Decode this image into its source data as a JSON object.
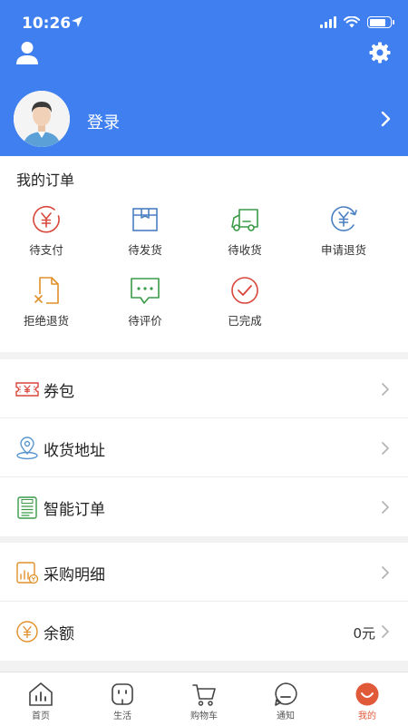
{
  "status_bar": {
    "time": "10:26"
  },
  "header": {
    "login_label": "登录"
  },
  "orders": {
    "title": "我的订单",
    "items": [
      {
        "label": "待支付",
        "icon": "yuan-circle-icon"
      },
      {
        "label": "待发货",
        "icon": "package-box-icon"
      },
      {
        "label": "待收货",
        "icon": "delivery-truck-icon"
      },
      {
        "label": "申请退货",
        "icon": "refund-cycle-icon"
      },
      {
        "label": "拒绝退货",
        "icon": "rejected-document-icon"
      },
      {
        "label": "待评价",
        "icon": "comment-bubble-icon"
      },
      {
        "label": "已完成",
        "icon": "check-circle-icon"
      }
    ]
  },
  "menu": {
    "coupon": {
      "label": "券包",
      "icon": "coupon-ticket-icon"
    },
    "address": {
      "label": "收货地址",
      "icon": "location-pin-icon"
    },
    "smart_order": {
      "label": "智能订单",
      "icon": "clipboard-list-icon"
    },
    "purchase_detail": {
      "label": "采购明细",
      "icon": "purchase-chart-icon"
    },
    "balance": {
      "label": "余额",
      "value": "0元",
      "icon": "yuan-coin-icon"
    }
  },
  "tabbar": {
    "items": [
      {
        "label": "首页",
        "icon": "home-chart-icon"
      },
      {
        "label": "生活",
        "icon": "life-face-icon"
      },
      {
        "label": "购物车",
        "icon": "shopping-cart-icon"
      },
      {
        "label": "通知",
        "icon": "notification-chat-icon"
      },
      {
        "label": "我的",
        "icon": "profile-smile-icon",
        "active": true
      }
    ]
  },
  "colors": {
    "header_blue": "#3f7ff0",
    "active_tab": "#e05a3a",
    "icon_red": "#d9463b",
    "icon_blue": "#4a7fc1",
    "icon_green": "#3a9a48",
    "icon_orange": "#e0902a"
  }
}
